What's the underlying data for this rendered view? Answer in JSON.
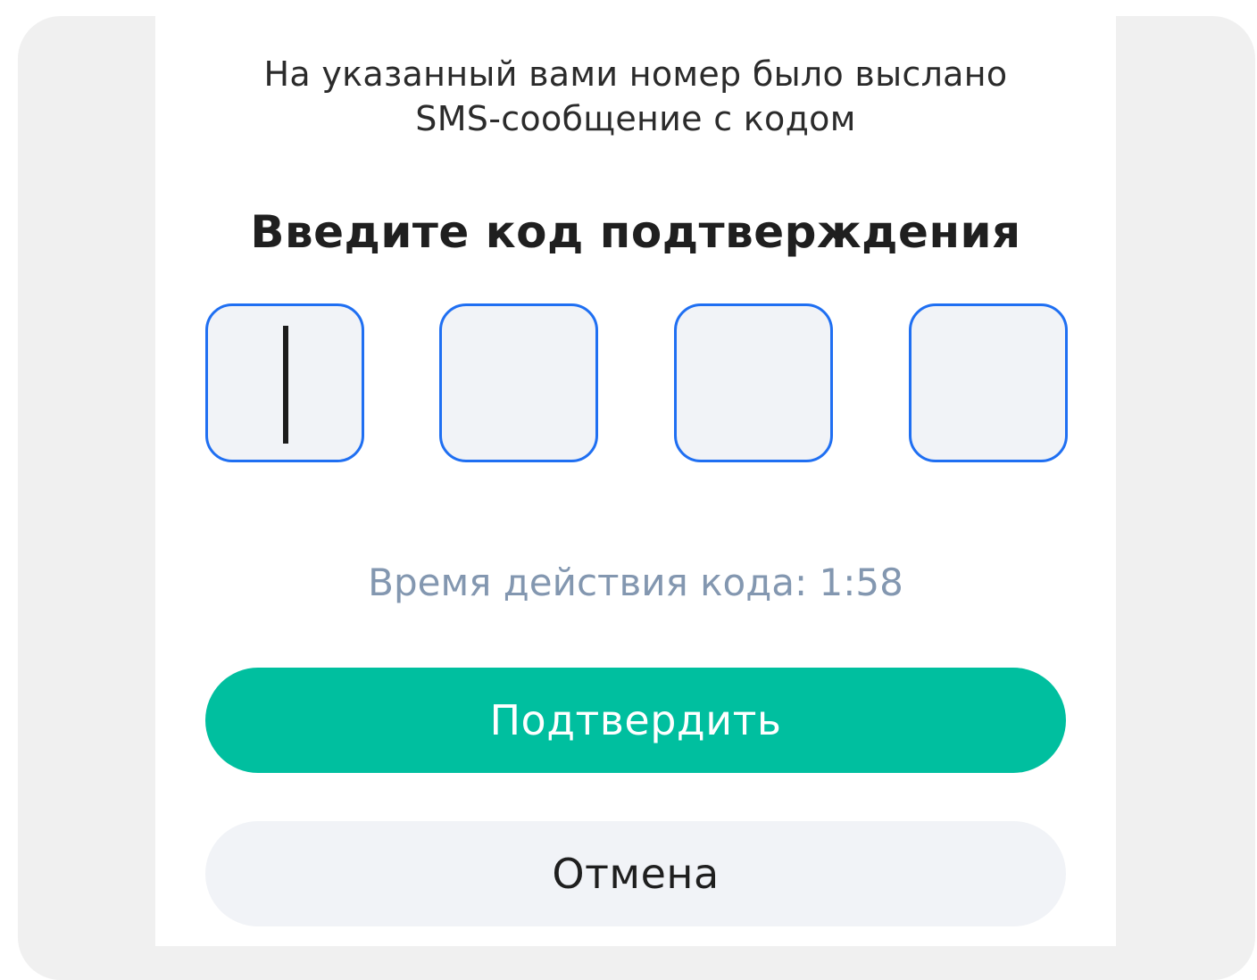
{
  "dialog": {
    "info_line1": "На указанный вами номер  было выслано",
    "info_line2": "SMS-сообщение с кодом",
    "title": "Введите код подтверждения",
    "code_digits": [
      "",
      "",
      "",
      ""
    ],
    "timer_text": "Время действия кода: 1:58",
    "confirm_label": "Подтвердить",
    "cancel_label": "Отмена"
  },
  "colors": {
    "accent_green": "#00bf9f",
    "field_border_blue": "#1f6ff2",
    "timer_text": "#8397b0",
    "field_background": "#f1f3f7"
  },
  "icons": {
    "cursor": "text-caret"
  }
}
